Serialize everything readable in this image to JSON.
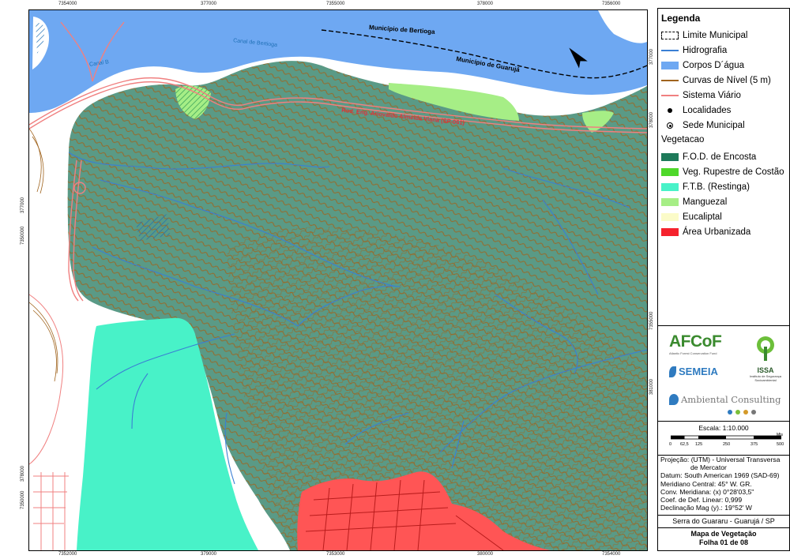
{
  "map": {
    "top_ticks": [
      "7354000",
      "377000",
      "7355000",
      "378000",
      "7356000"
    ],
    "bottom_ticks": [
      "7352000",
      "379000",
      "7353000",
      "380000",
      "7354000"
    ],
    "right_ticks": [
      "377000",
      "378000",
      "7355000",
      "381000"
    ],
    "left_ticks": [
      "377000",
      "7350000",
      "378000",
      "7350000"
    ],
    "labels": {
      "municipio_bertioga": "Município de Bertioga",
      "municipio_guaruja": "Município de Guarujá",
      "canal_bertioga": "Canal de Bertioga",
      "canal_b": "Canal B",
      "rodovia": "Rod. Eng. Ariovaldo Almeida Viana (SP-061)"
    },
    "north_symbol": "N"
  },
  "legend": {
    "title": "Legenda",
    "items": [
      {
        "label": "Limite Municipal",
        "symbol": "dashed-box",
        "color": "#000000"
      },
      {
        "label": "Hidrografia",
        "symbol": "line",
        "color": "#3a7fd4"
      },
      {
        "label": "Corpos D´água",
        "symbol": "fill",
        "color": "#6ea8f2"
      },
      {
        "label": "Curvas de Nível (5 m)",
        "symbol": "line",
        "color": "#a0641e"
      },
      {
        "label": "Sistema Viário",
        "symbol": "line",
        "color": "#f08080"
      },
      {
        "label": "Localidades",
        "symbol": "dot",
        "color": "#000000"
      },
      {
        "label": "Sede Municipal",
        "symbol": "ring-dot",
        "color": "#000000"
      }
    ],
    "vegetation_heading": "Vegetacao",
    "vegetation": [
      {
        "label": "F.O.D. de Encosta",
        "color": "#1e7a5a"
      },
      {
        "label": "Veg. Rupestre de Costão",
        "color": "#4ed82a"
      },
      {
        "label": "F.T.B. (Restinga)",
        "color": "#48f2c8"
      },
      {
        "label": "Manguezal",
        "color": "#a6ee86"
      },
      {
        "label": "Eucaliptal",
        "color": "#fbfbc8"
      },
      {
        "label": "Área Urbanizada",
        "color": "#f5222d"
      }
    ]
  },
  "logos": {
    "afcof": "AFCoF",
    "afcof_sub": "Atlantic Forest Conservation Fund",
    "semeia": "SEMEIA",
    "issa": "ISSA",
    "issa_sub": "Instituto de Segurança Socioambiental",
    "ambiental": "Ambiental Consulting"
  },
  "scale": {
    "label": "Escala: 1:10.000",
    "ticks": [
      "0",
      "62,5",
      "125",
      "250",
      "375",
      "500"
    ],
    "unit": "Mts"
  },
  "projection": [
    "Projeção: (UTM) - Universal Transversa",
    "de Mercator",
    "Datum: South American 1969 (SAD-69)",
    "Meridiano Central: 45° W. GR.",
    "Conv. Meridiana: (x) 0°28'03,5\"",
    "Coef. de Def. Linear: 0,999",
    "Declinação Mag (y).: 19°52' W"
  ],
  "place": "Serra do Guararu - Guarujá / SP",
  "title_line1": "Mapa de Vegetação",
  "title_line2": "Folha 01 de 08",
  "colors": {
    "water": "#6ea8f2",
    "forest": "#5a9a86",
    "contour": "#a0641e",
    "restinga": "#48f2c8",
    "urban": "#f5222d",
    "mangrove": "#a6ee86",
    "road": "#f08080"
  }
}
